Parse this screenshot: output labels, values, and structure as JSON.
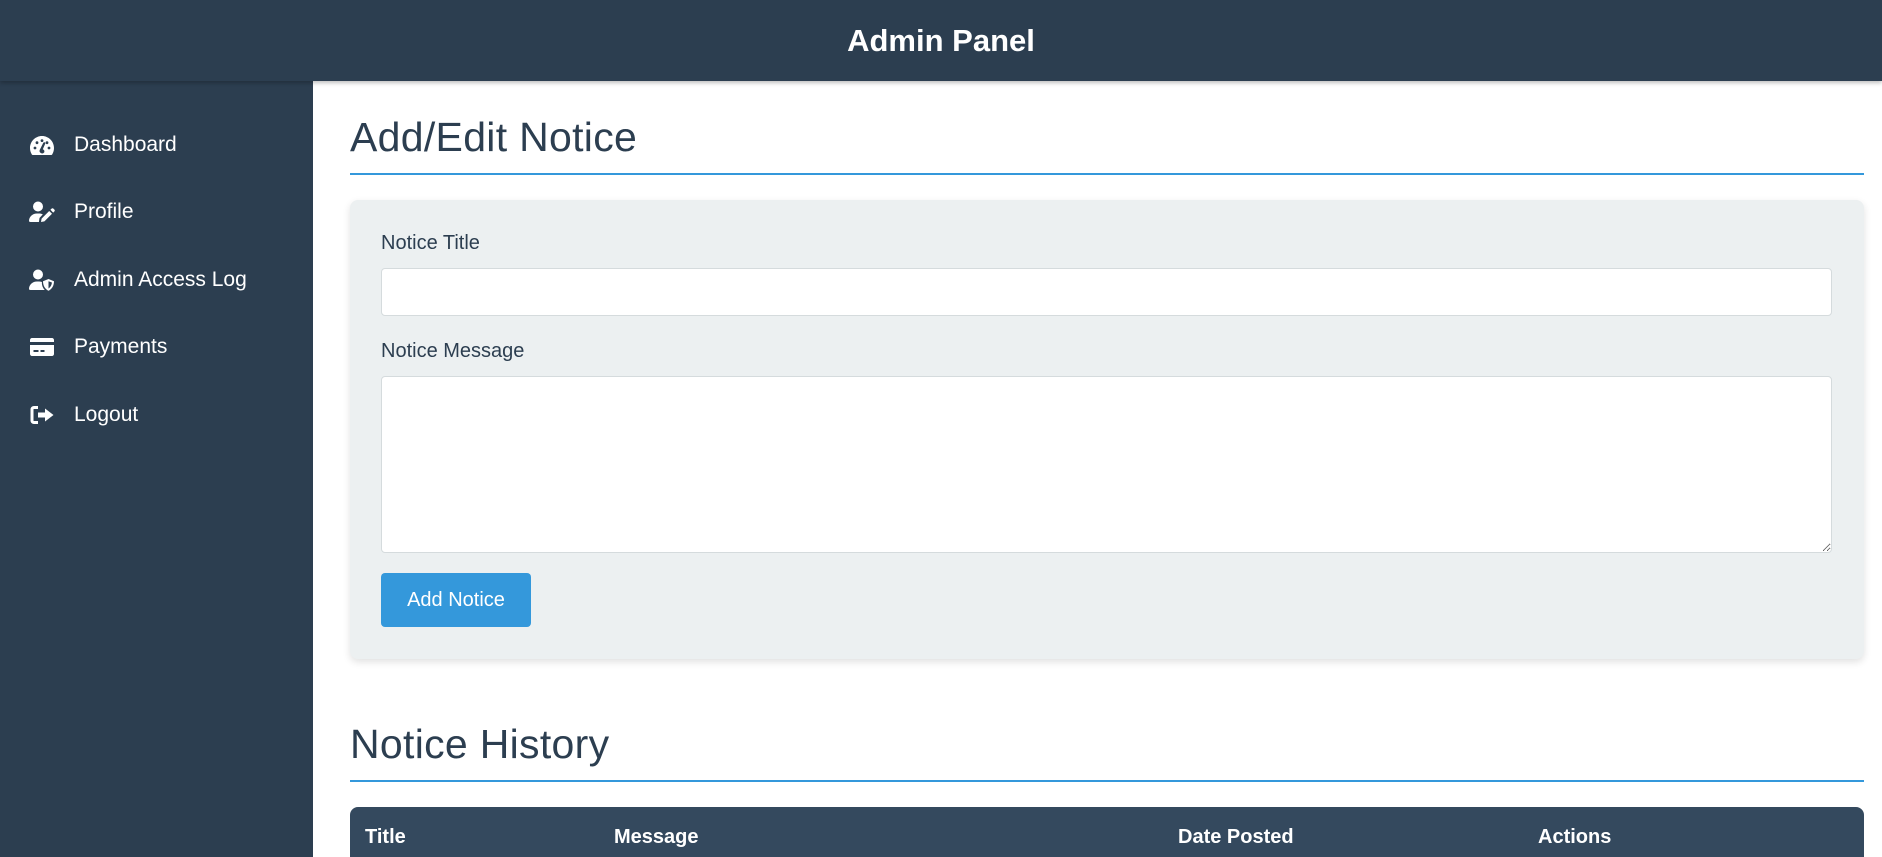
{
  "header": {
    "title": "Admin Panel"
  },
  "sidebar": {
    "items": [
      {
        "label": "Dashboard",
        "icon": "gauge-icon"
      },
      {
        "label": "Profile",
        "icon": "user-edit-icon"
      },
      {
        "label": "Admin Access Log",
        "icon": "user-shield-icon"
      },
      {
        "label": "Payments",
        "icon": "credit-card-icon"
      },
      {
        "label": "Logout",
        "icon": "sign-out-icon"
      }
    ]
  },
  "form": {
    "heading": "Add/Edit Notice",
    "title_label": "Notice Title",
    "title_value": "",
    "message_label": "Notice Message",
    "message_value": "",
    "submit_label": "Add Notice"
  },
  "history": {
    "heading": "Notice History",
    "columns": [
      "Title",
      "Message",
      "Date Posted",
      "Actions"
    ]
  },
  "colors": {
    "primary_dark": "#2c3e50",
    "accent": "#3498db",
    "card_bg": "#ecf0f1",
    "table_header": "#34495e"
  }
}
